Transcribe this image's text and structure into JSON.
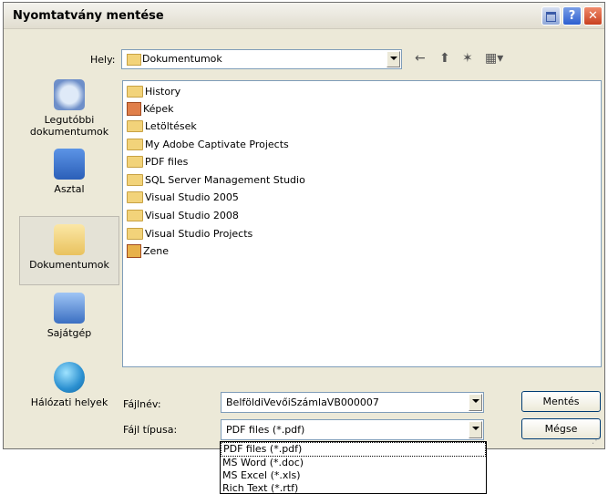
{
  "dialog": {
    "title": "Nyomtatvány mentése",
    "icons": {
      "minimize": "minimize-icon",
      "help": "help-icon",
      "close": "close-icon"
    }
  },
  "location": {
    "label": "Hely:",
    "value": "Dokumentumok"
  },
  "toolbar": {
    "back_icon": "←",
    "up_icon": "⬆",
    "new_folder_icon": "✶",
    "view_icon": "▦▾"
  },
  "sidebar": {
    "items": [
      {
        "label": "Legutóbbi dokumentumok",
        "icon": "recent-icon"
      },
      {
        "label": "Asztal",
        "icon": "desktop-icon"
      },
      {
        "label": "Dokumentumok",
        "icon": "documents-icon"
      },
      {
        "label": "Sajátgép",
        "icon": "computer-icon"
      },
      {
        "label": "Hálózati helyek",
        "icon": "network-icon"
      }
    ]
  },
  "files": [
    "History",
    "Képek",
    "Letöltések",
    "My Adobe Captivate Projects",
    "PDF files",
    "SQL Server Management Studio",
    "Visual Studio 2005",
    "Visual Studio 2008",
    "Visual Studio Projects",
    "Zene"
  ],
  "filename": {
    "label": "Fájlnév:",
    "value": "BelföldiVevőiSzámlaVB000007"
  },
  "filetype": {
    "label": "Fájl típusa:",
    "value": "PDF files (*.pdf)",
    "options": [
      "PDF files (*.pdf)",
      "MS Word (*.doc)",
      "MS Excel (*.xls)",
      "Rich Text (*.rtf)"
    ]
  },
  "buttons": {
    "save": "Mentés",
    "cancel": "Mégse"
  },
  "colors": {
    "dialog_bg": "#ece9d8",
    "close_button": "#c8401f",
    "help_button": "#2d5fd0"
  }
}
